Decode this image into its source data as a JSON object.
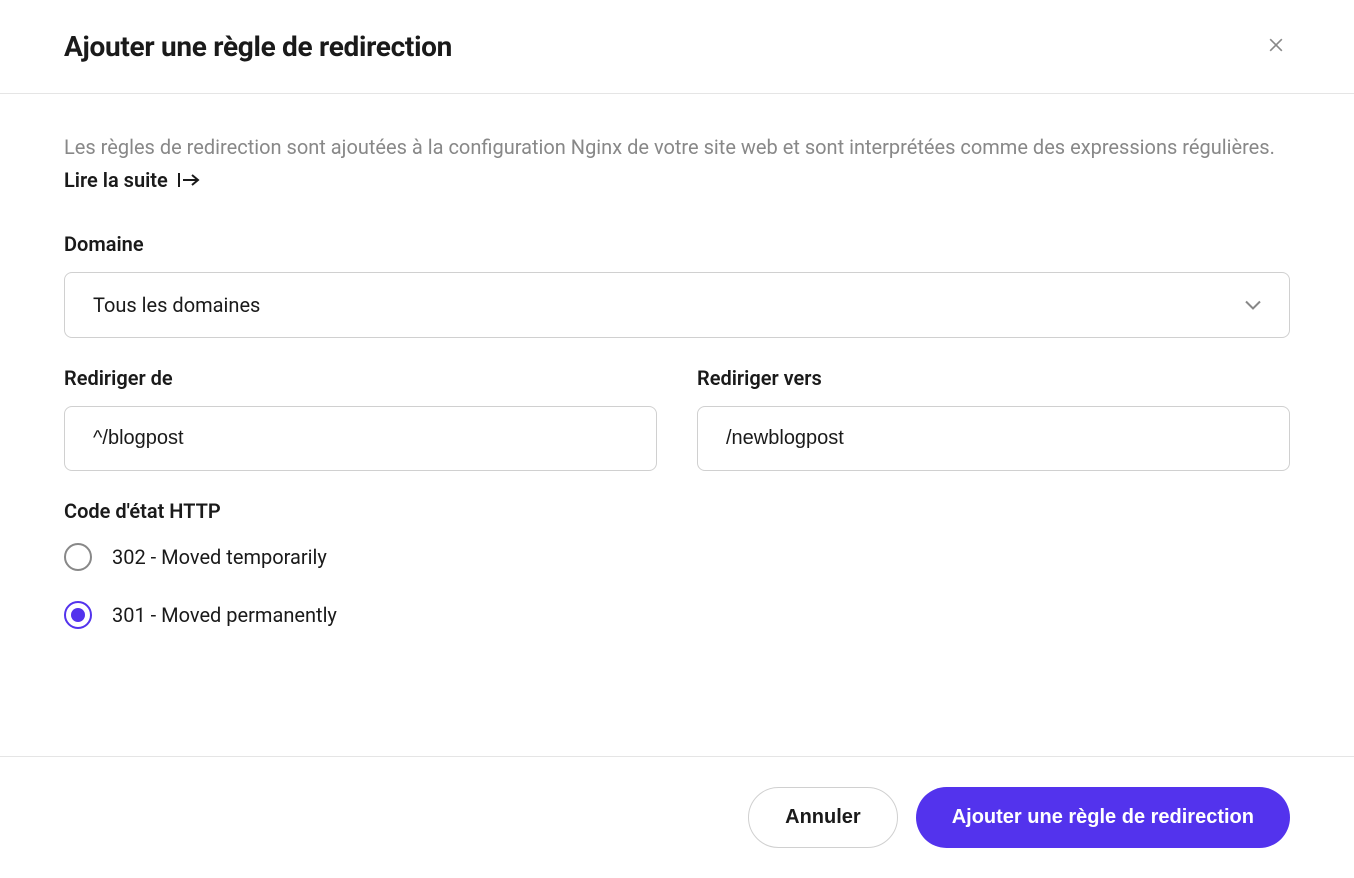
{
  "header": {
    "title": "Ajouter une règle de redirection"
  },
  "body": {
    "description": "Les règles de redirection sont ajoutées à la configuration Nginx de votre site web et sont interprétées comme des expressions régulières.",
    "read_more_label": "Lire la suite"
  },
  "form": {
    "domain": {
      "label": "Domaine",
      "value": "Tous les domaines"
    },
    "redirect_from": {
      "label": "Rediriger de",
      "value": "^/blogpost"
    },
    "redirect_to": {
      "label": "Rediriger vers",
      "value": "/newblogpost"
    },
    "status_code": {
      "label": "Code d'état HTTP",
      "options": [
        {
          "label": "302 - Moved temporarily",
          "selected": false
        },
        {
          "label": "301 - Moved permanently",
          "selected": true
        }
      ]
    }
  },
  "footer": {
    "cancel_label": "Annuler",
    "submit_label": "Ajouter une règle de redirection"
  }
}
